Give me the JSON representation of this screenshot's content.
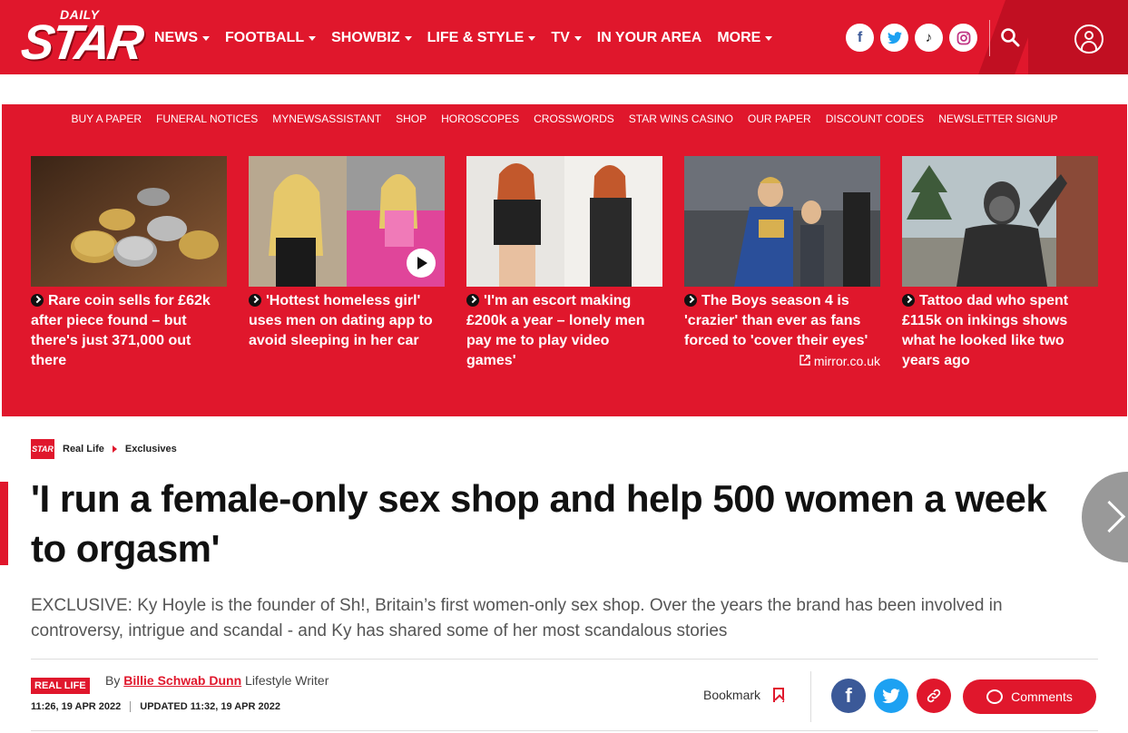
{
  "header": {
    "logo_small": "DAILY",
    "logo_big": "STAR",
    "nav": [
      {
        "label": "NEWS",
        "has_caret": true
      },
      {
        "label": "FOOTBALL",
        "has_caret": true
      },
      {
        "label": "SHOWBIZ",
        "has_caret": true
      },
      {
        "label": "LIFE & STYLE",
        "has_caret": true
      },
      {
        "label": "TV",
        "has_caret": true
      },
      {
        "label": "IN YOUR AREA",
        "has_caret": false
      },
      {
        "label": "MORE",
        "has_caret": true
      }
    ],
    "social": [
      "facebook-icon",
      "twitter-icon",
      "tiktok-icon",
      "instagram-icon"
    ]
  },
  "subnav": [
    "BUY A PAPER",
    "FUNERAL NOTICES",
    "MYNEWSASSISTANT",
    "SHOP",
    "HOROSCOPES",
    "CROSSWORDS",
    "STAR WINS CASINO",
    "OUR PAPER",
    "DISCOUNT CODES",
    "NEWSLETTER SIGNUP"
  ],
  "cards": [
    {
      "title": "Rare coin sells for £62k after piece found – but there's just 371,000 out there",
      "source": ""
    },
    {
      "title": "'Hottest homeless girl' uses men on dating app to avoid sleeping in her car",
      "source": ""
    },
    {
      "title": "'I'm an escort making £200k a year – lonely men pay me to play video games'",
      "source": ""
    },
    {
      "title": "The Boys season 4 is 'crazier' than ever as fans forced to 'cover their eyes'",
      "source": "mirror.co.uk"
    },
    {
      "title": "Tattoo dad who spent £115k on inkings shows what he looked like two years ago",
      "source": ""
    }
  ],
  "breadcrumb": {
    "logo": "STAR",
    "items": [
      "Real Life",
      "Exclusives"
    ]
  },
  "article": {
    "headline": "'I run a female-only sex shop and help 500 women a week to orgasm'",
    "standfirst": "EXCLUSIVE: Ky Hoyle is the founder of Sh!, Britain’s first women-only sex shop. Over the years the brand has been involved in controversy, intrigue and scandal - and Ky has shared some of her most scandalous stories",
    "tag": "REAL LIFE",
    "by": "By",
    "author": "Billie Schwab Dunn",
    "role": "Lifestyle Writer",
    "published": "11:26, 19 APR 2022",
    "updated": "UPDATED 11:32, 19 APR 2022"
  },
  "actions": {
    "bookmark": "Bookmark",
    "comments": "Comments",
    "share": [
      {
        "icon": "facebook-icon",
        "color": "#3b5998",
        "glyph": "f"
      },
      {
        "icon": "twitter-icon",
        "color": "#1da1f2",
        "glyph": "t"
      },
      {
        "icon": "link-icon",
        "color": "#e0172c",
        "glyph": "⛓"
      }
    ]
  },
  "colors": {
    "brand": "#e0172c",
    "brand_dark": "#c10f22"
  }
}
